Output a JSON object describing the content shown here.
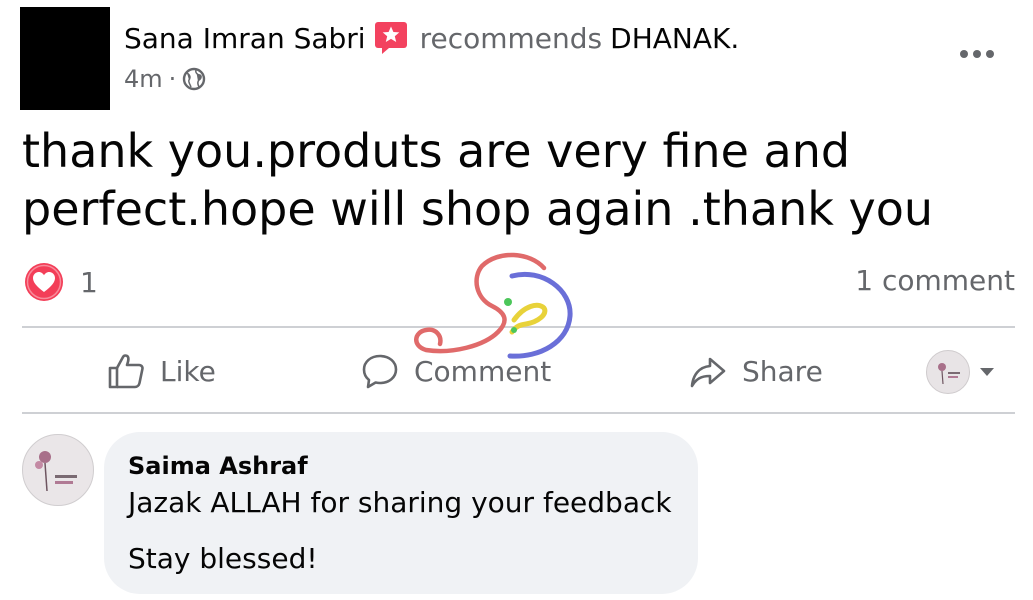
{
  "post": {
    "author": "Sana Imran Sabri",
    "action_text": "recommends",
    "page_name": "DHANAK",
    "page_suffix": ".",
    "time": "4m",
    "separator": "·",
    "audience_icon": "globe-icon",
    "more_icon": "more-options-icon",
    "text_line1": "thank you.produts are very fine and",
    "text_line2": "perfect.hope will shop again .thank you"
  },
  "reactions": {
    "icon": "love-reaction-icon",
    "count": "1",
    "comments_count_label": "1 comment"
  },
  "actions": {
    "like_label": "Like",
    "comment_label": "Comment",
    "share_label": "Share"
  },
  "comment": {
    "author": "Saima Ashraf",
    "line1": "Jazak ALLAH for sharing your feedback",
    "line2": "Stay blessed!"
  },
  "colors": {
    "secondary_text": "#65676b",
    "primary_text": "#050505",
    "love_red": "#f33e58",
    "recommend_badge": "#f3425f",
    "bubble_bg": "#f0f2f5",
    "divider": "#ced0d4"
  }
}
